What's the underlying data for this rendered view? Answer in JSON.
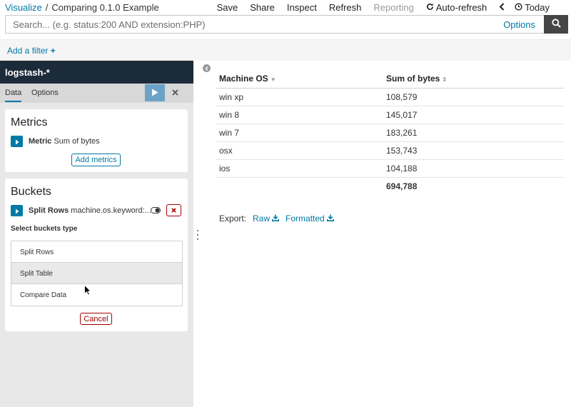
{
  "breadcrumb": {
    "root": "Visualize",
    "separator": "/",
    "current": "Comparing 0.1.0 Example"
  },
  "topnav": {
    "save": "Save",
    "share": "Share",
    "inspect": "Inspect",
    "refresh": "Refresh",
    "reporting": "Reporting",
    "auto_refresh": "Auto-refresh",
    "time": "Today"
  },
  "search": {
    "placeholder": "Search... (e.g. status:200 AND extension:PHP)",
    "options_label": "Options"
  },
  "filter_bar": {
    "add_filter": "Add a filter"
  },
  "sidebar": {
    "index_pattern": "logstash-*",
    "tabs": [
      "Data",
      "Options"
    ],
    "metrics": {
      "title": "Metrics",
      "metric_type": "Metric",
      "metric_desc": "Sum of bytes",
      "add_button": "Add metrics"
    },
    "buckets": {
      "title": "Buckets",
      "agg_type": "Split Rows",
      "agg_desc": "machine.os.keyword:...",
      "select_label": "Select buckets type",
      "types": [
        "Split Rows",
        "Split Table",
        "Compare Data"
      ],
      "cancel_button": "Cancel"
    }
  },
  "table": {
    "columns": [
      "Machine OS",
      "Sum of bytes"
    ],
    "rows": [
      [
        "win xp",
        "108,579"
      ],
      [
        "win 8",
        "145,017"
      ],
      [
        "win 7",
        "183,261"
      ],
      [
        "osx",
        "153,743"
      ],
      [
        "ios",
        "104,188"
      ]
    ],
    "total": "694,788"
  },
  "export": {
    "label": "Export:",
    "raw": "Raw",
    "formatted": "Formatted"
  },
  "colors": {
    "accent": "#0079a5",
    "sidebar_header": "#1c2b3a",
    "danger": "#a30000"
  }
}
